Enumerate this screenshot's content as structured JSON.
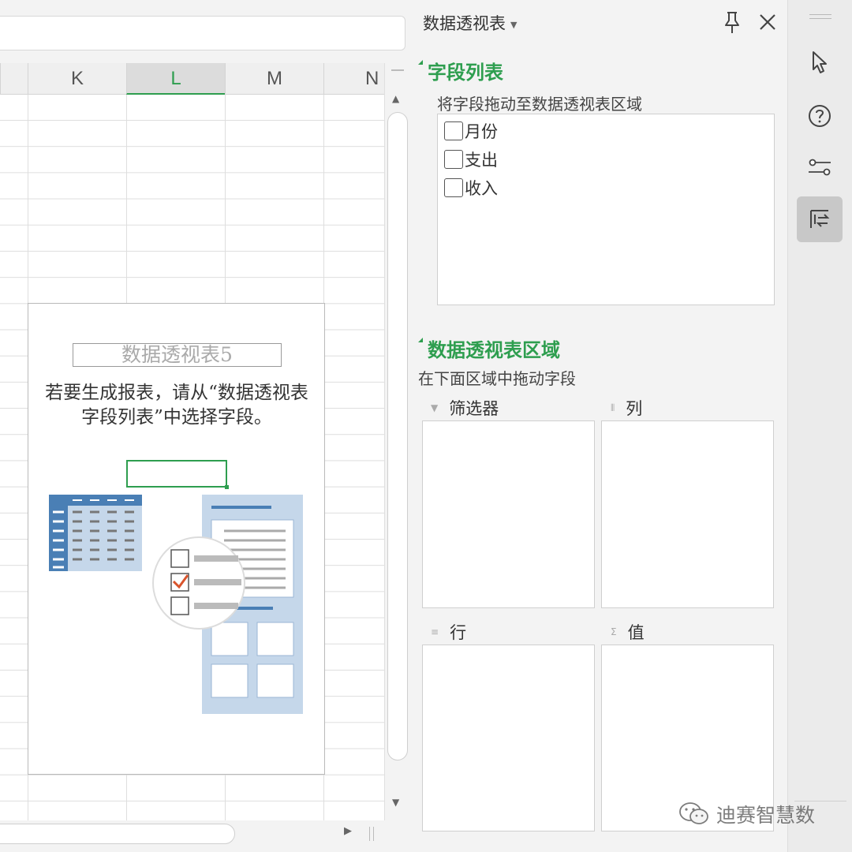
{
  "sheet": {
    "columns": [
      "K",
      "L",
      "M",
      "N"
    ],
    "active_column": "L",
    "pivot_placeholder": {
      "title": "数据透视表5",
      "hint": "若要生成报表，请从“数据透视表字段列表”中选择字段。"
    }
  },
  "panel": {
    "title": "数据透视表",
    "field_list": {
      "heading": "字段列表",
      "hint": "将字段拖动至数据透视表区域",
      "fields": [
        {
          "label": "月份",
          "checked": false
        },
        {
          "label": "支出",
          "checked": false
        },
        {
          "label": "收入",
          "checked": false
        }
      ]
    },
    "areas": {
      "heading": "数据透视表区域",
      "hint": "在下面区域中拖动字段",
      "filter_label": "筛选器",
      "columns_label": "列",
      "rows_label": "行",
      "values_label": "值"
    }
  },
  "toolbar": {
    "icons": [
      "pointer-icon",
      "help-icon",
      "settings-sliders-icon",
      "pivot-fields-icon"
    ],
    "active": "pivot-fields-icon"
  },
  "watermark": {
    "text": "迪赛智慧数"
  },
  "colors": {
    "accent": "#2e9e4f",
    "pivot_blue": "#4a7fb5",
    "pivot_light": "#c5d7ea"
  }
}
